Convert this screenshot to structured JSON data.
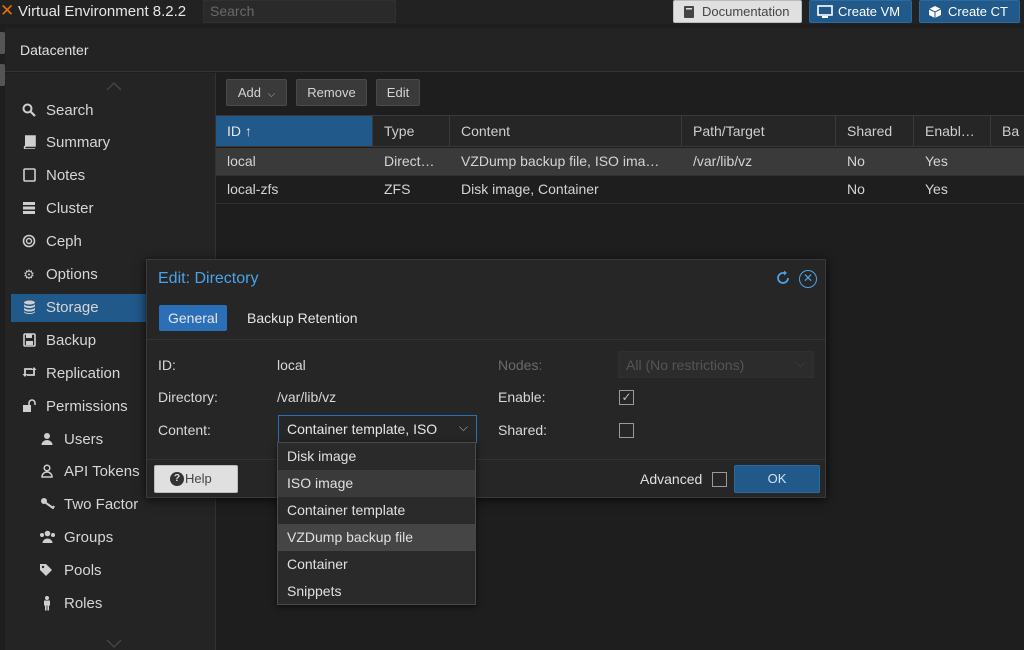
{
  "app": {
    "title": "Virtual Environment 8.2.2",
    "search_placeholder": "Search",
    "buttons": {
      "documentation": "Documentation",
      "create_vm": "Create VM",
      "create_ct": "Create CT"
    }
  },
  "header": {
    "title": "Datacenter"
  },
  "sidebar": {
    "items": [
      {
        "label": "Search",
        "icon": "search-icon"
      },
      {
        "label": "Summary",
        "icon": "book-icon"
      },
      {
        "label": "Notes",
        "icon": "notes-icon"
      },
      {
        "label": "Cluster",
        "icon": "server-icon"
      },
      {
        "label": "Ceph",
        "icon": "ceph-icon"
      },
      {
        "label": "Options",
        "icon": "gear-icon"
      },
      {
        "label": "Storage",
        "icon": "database-icon"
      },
      {
        "label": "Backup",
        "icon": "floppy-icon"
      },
      {
        "label": "Replication",
        "icon": "retweet-icon"
      },
      {
        "label": "Permissions",
        "icon": "unlock-icon"
      },
      {
        "label": "Users",
        "icon": "user-icon"
      },
      {
        "label": "API Tokens",
        "icon": "user-outline-icon"
      },
      {
        "label": "Two Factor",
        "icon": "key-icon"
      },
      {
        "label": "Groups",
        "icon": "users-icon"
      },
      {
        "label": "Pools",
        "icon": "tags-icon"
      },
      {
        "label": "Roles",
        "icon": "male-icon"
      }
    ],
    "active": "Storage"
  },
  "toolbar": {
    "add": "Add",
    "remove": "Remove",
    "edit": "Edit"
  },
  "grid": {
    "columns": [
      "ID ↑",
      "Type",
      "Content",
      "Path/Target",
      "Shared",
      "Enabl…",
      "Ba"
    ],
    "rows": [
      {
        "id": "local",
        "type": "Direct…",
        "content": "VZDump backup file, ISO ima…",
        "path": "/var/lib/vz",
        "shared": "No",
        "enabled": "Yes"
      },
      {
        "id": "local-zfs",
        "type": "ZFS",
        "content": "Disk image, Container",
        "path": "",
        "shared": "No",
        "enabled": "Yes"
      }
    ]
  },
  "dialog": {
    "title": "Edit: Directory",
    "tabs": {
      "general": "General",
      "backup_retention": "Backup Retention"
    },
    "fields": {
      "id_label": "ID:",
      "id_value": "local",
      "directory_label": "Directory:",
      "directory_value": "/var/lib/vz",
      "content_label": "Content:",
      "content_value": "Container template, ISO",
      "nodes_label": "Nodes:",
      "nodes_value": "All (No restrictions)",
      "enable_label": "Enable:",
      "enable_checked": true,
      "shared_label": "Shared:",
      "shared_checked": false
    },
    "footer": {
      "help": "Help",
      "advanced": "Advanced",
      "ok": "OK"
    }
  },
  "content_options": [
    "Disk image",
    "ISO image",
    "Container template",
    "VZDump backup file",
    "Container",
    "Snippets"
  ],
  "colors": {
    "accent": "#21598a",
    "link": "#4aa3e8",
    "brand": "#e57000"
  }
}
